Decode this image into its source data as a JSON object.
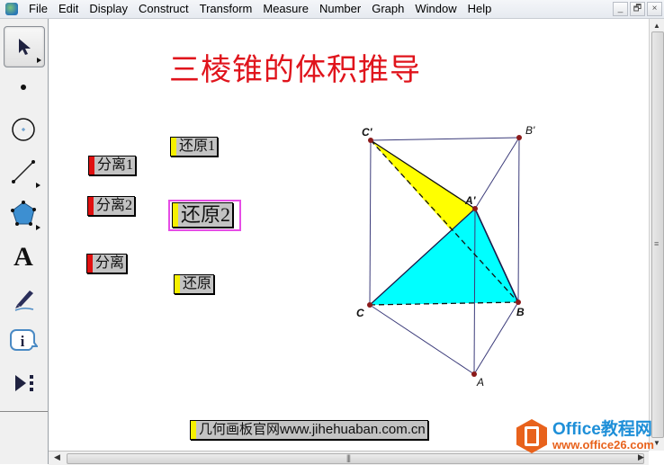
{
  "menubar": {
    "app_icon": "sketchpad-app-icon",
    "items": [
      "File",
      "Edit",
      "Display",
      "Construct",
      "Transform",
      "Measure",
      "Number",
      "Graph",
      "Window",
      "Help"
    ],
    "window_buttons": {
      "minimize": "_",
      "restore": "🗗",
      "close": "×"
    }
  },
  "toolbar": {
    "tools": [
      {
        "name": "arrow-select-tool",
        "icon": "arrow-icon",
        "selected": true
      },
      {
        "name": "point-tool",
        "icon": "point-icon"
      },
      {
        "name": "compass-tool",
        "icon": "compass-icon"
      },
      {
        "name": "straightedge-tool",
        "icon": "segment-icon"
      },
      {
        "name": "polygon-tool",
        "icon": "polygon-icon"
      },
      {
        "name": "text-tool",
        "icon": "text-icon",
        "glyph": "A"
      },
      {
        "name": "marker-tool",
        "icon": "marker-pen-icon"
      },
      {
        "name": "information-tool",
        "icon": "info-icon",
        "glyph": "i"
      },
      {
        "name": "custom-tool",
        "icon": "custom-tool-icon"
      }
    ]
  },
  "canvas": {
    "title": "三棱锥的体积推导",
    "title_color": "#e0141c",
    "buttons": {
      "restore1": "还原1",
      "separate1": "分离1",
      "separate2": "分离2",
      "restore2": "还原2",
      "separate": "分离",
      "restore": "还原"
    },
    "link_button": "几何画板官网www.jihehuaban.com.cn",
    "figure": {
      "points": {
        "C_prime": "C'",
        "B_prime": "B'",
        "A_prime": "A'",
        "C": "C",
        "B": "B",
        "A": "A"
      },
      "colors": {
        "yellow_face": "#ffff00",
        "cyan_face": "#00ffff",
        "prism_edge": "#3b3b7a",
        "point": "#8b1a1a"
      }
    }
  },
  "watermark": {
    "line1": "Office教程网",
    "line2": "www.office26.com"
  },
  "scrollbars": {
    "vertical_grip": "≡",
    "horizontal_grip": "|||"
  }
}
